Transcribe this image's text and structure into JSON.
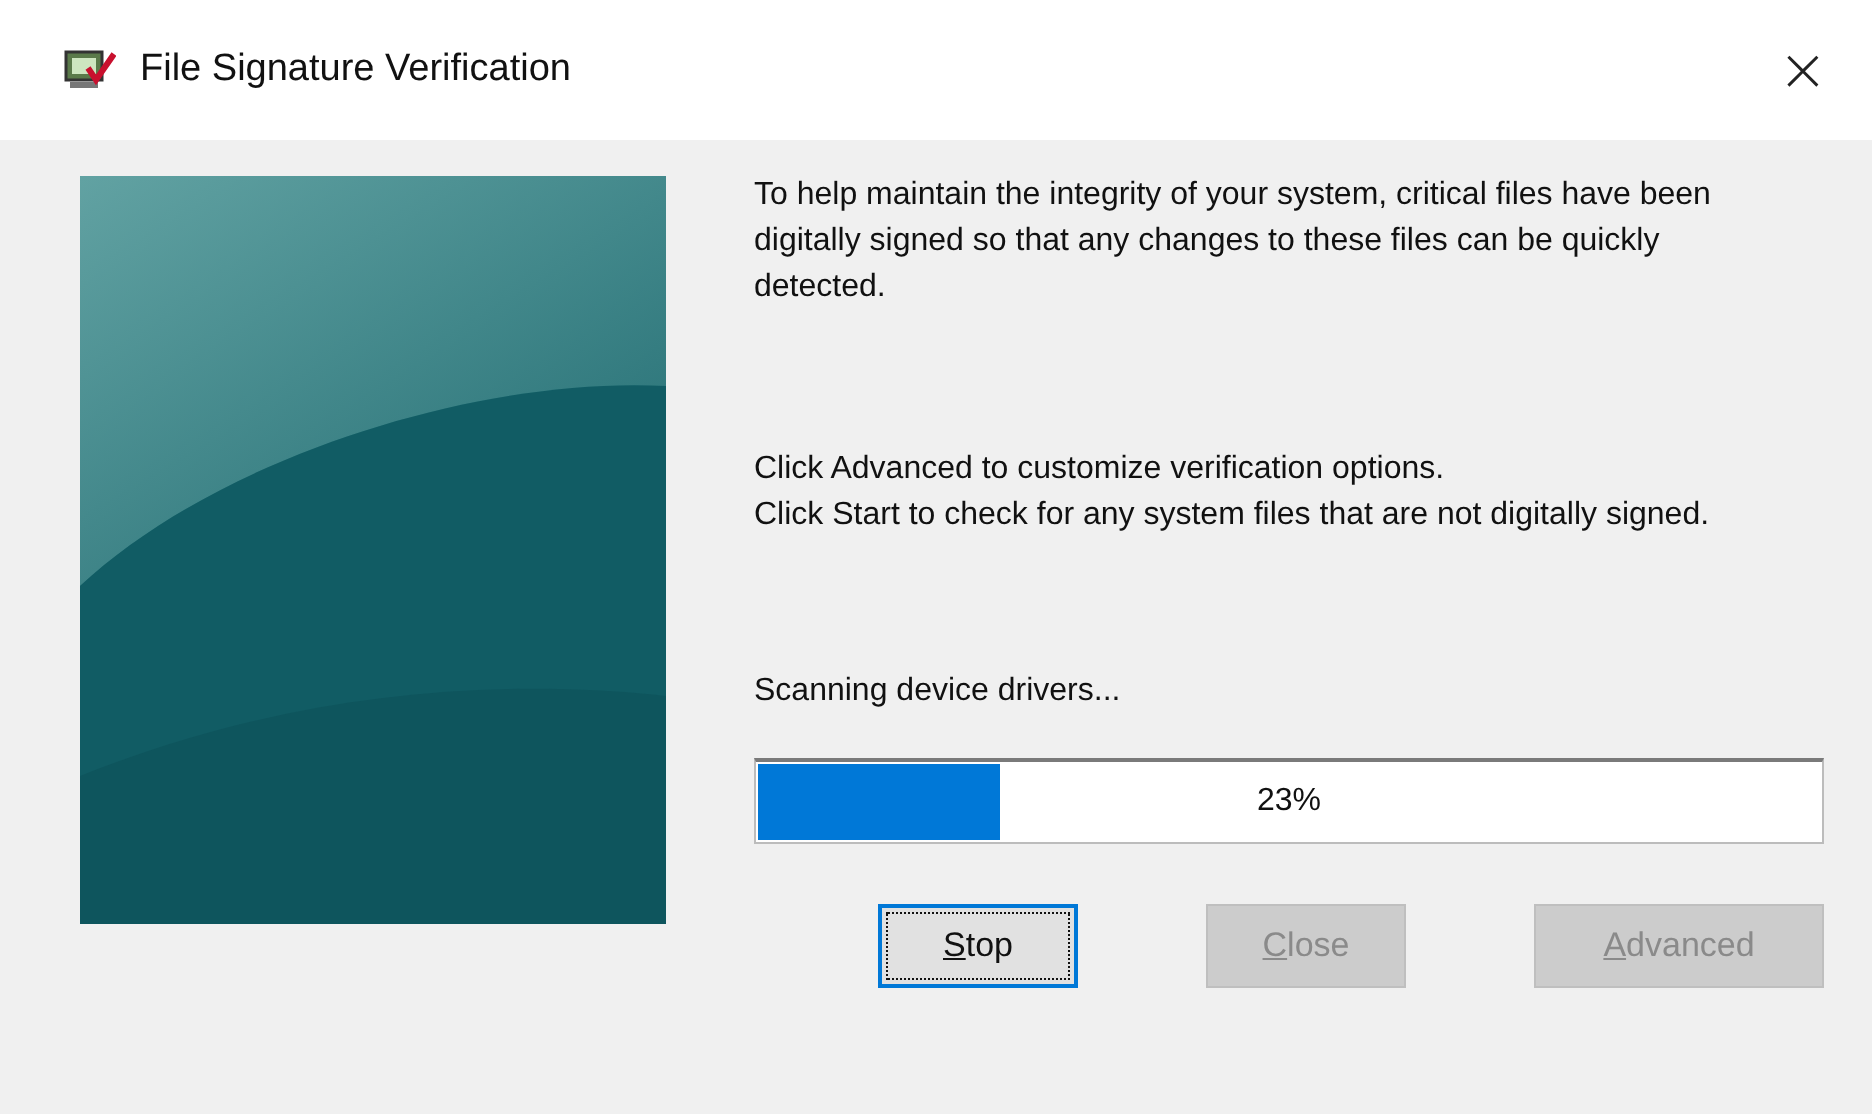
{
  "window": {
    "title": "File Signature Verification",
    "close": "×"
  },
  "paragraphs": [
    "To help maintain the integrity of your system, critical files have been digitally signed so that any changes to these files can be quickly detected.",
    "Click Advanced to customize verification options.\nClick Start to check for any system files that are not digitally signed."
  ],
  "status": "Scanning device drivers...",
  "progress": {
    "level": 0.23,
    "reading": "23%"
  },
  "buttons": [
    {
      "label": "Stop",
      "disabled": false,
      "focused": true
    },
    {
      "label": "Close",
      "disabled": true,
      "focused": false
    },
    {
      "label": "Advanced",
      "disabled": true,
      "focused": false
    }
  ]
}
